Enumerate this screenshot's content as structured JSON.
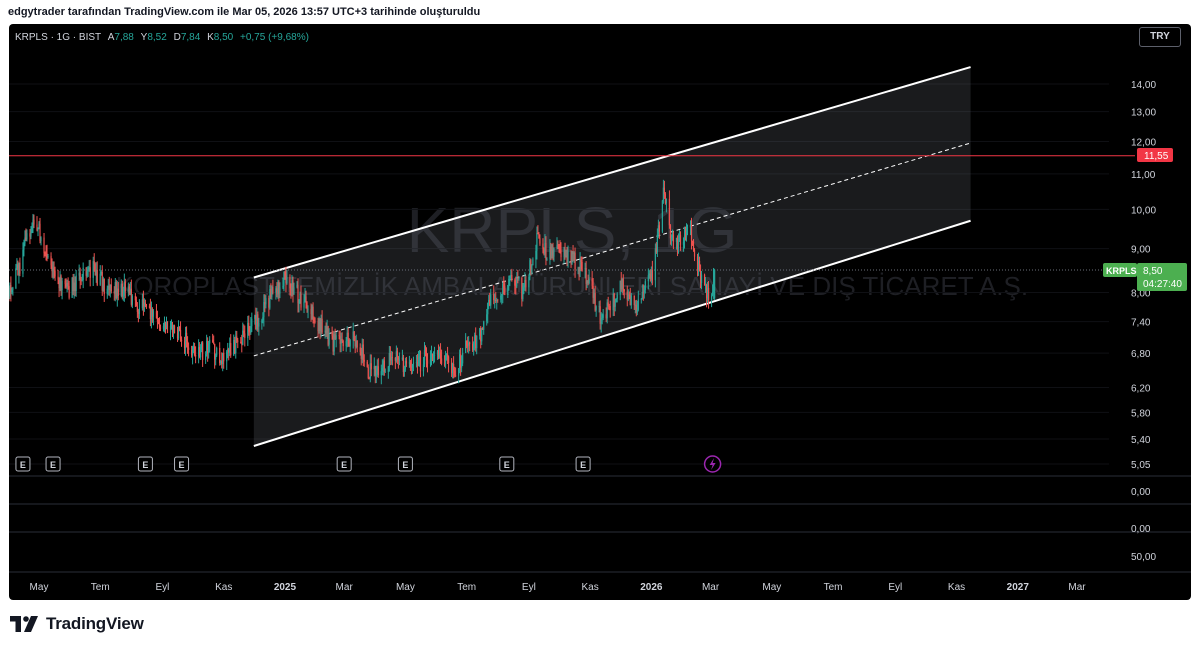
{
  "caption": "edgytrader tarafından TradingView.com ile Mar 05, 2026 13:57 UTC+3 tarihinde oluşturuldu",
  "header": {
    "symbol": "KRPLS · 1G · BIST",
    "open_label": "A",
    "open_value": "7,88",
    "high_label": "Y",
    "high_value": "8,52",
    "low_label": "D",
    "low_value": "7,84",
    "close_label": "K",
    "close_value": "8,50",
    "change": "+0,75 (+9,68%)",
    "currency": "TRY"
  },
  "watermark": {
    "symbol": "KRPLS, 1G",
    "company": "KOROPLAST TEMİZLİK AMBALAJ ÜRÜNLERİ SANAYİ VE DIŞ TİCARET A.Ş."
  },
  "price_badge": {
    "symbol": "KRPLS",
    "price": "8,50",
    "countdown": "04:27:40"
  },
  "level_badge": "11,55",
  "pane_labels": [
    "0,00",
    "0,00",
    "50,00"
  ],
  "earnings_marker": "E",
  "brand": "TradingView",
  "colors": {
    "up": "#26a69a",
    "down": "#ef5350",
    "resistance": "#f23645",
    "price_badge": "#4caf50",
    "flash": "#9c27b0"
  },
  "chart_data": {
    "type": "candlestick",
    "y_scale": "log",
    "y_ticks": [
      14.0,
      13.0,
      12.0,
      11.0,
      10.0,
      9.0,
      8.0,
      7.4,
      6.8,
      6.2,
      5.8,
      5.4,
      5.05
    ],
    "y_tick_labels": [
      "14,00",
      "13,00",
      "12,00",
      "11,00",
      "10,00",
      "9,00",
      "8,00",
      "7,40",
      "6,80",
      "6,20",
      "5,80",
      "5,40",
      "5,05"
    ],
    "x_ticks": [
      {
        "date": "2024-05-01",
        "label": "May",
        "bold": false
      },
      {
        "date": "2024-07-01",
        "label": "Tem",
        "bold": false
      },
      {
        "date": "2024-09-01",
        "label": "Eyl",
        "bold": false
      },
      {
        "date": "2024-11-01",
        "label": "Kas",
        "bold": false
      },
      {
        "date": "2025-01-01",
        "label": "2025",
        "bold": true
      },
      {
        "date": "2025-03-01",
        "label": "Mar",
        "bold": false
      },
      {
        "date": "2025-05-01",
        "label": "May",
        "bold": false
      },
      {
        "date": "2025-07-01",
        "label": "Tem",
        "bold": false
      },
      {
        "date": "2025-09-01",
        "label": "Eyl",
        "bold": false
      },
      {
        "date": "2025-11-01",
        "label": "Kas",
        "bold": false
      },
      {
        "date": "2026-01-01",
        "label": "2026",
        "bold": true
      },
      {
        "date": "2026-03-01",
        "label": "Mar",
        "bold": false
      },
      {
        "date": "2026-05-01",
        "label": "May",
        "bold": false
      },
      {
        "date": "2026-07-01",
        "label": "Tem",
        "bold": false
      },
      {
        "date": "2026-09-01",
        "label": "Eyl",
        "bold": false
      },
      {
        "date": "2026-11-01",
        "label": "Kas",
        "bold": false
      },
      {
        "date": "2027-01-01",
        "label": "2027",
        "bold": true
      },
      {
        "date": "2027-03-01",
        "label": "Mar",
        "bold": false
      }
    ],
    "price_path": [
      [
        "2024-04-01",
        8.1
      ],
      [
        "2024-04-12",
        8.6
      ],
      [
        "2024-04-22",
        9.5
      ],
      [
        "2024-04-28",
        9.8
      ],
      [
        "2024-05-06",
        8.8
      ],
      [
        "2024-05-16",
        8.4
      ],
      [
        "2024-05-28",
        8.0
      ],
      [
        "2024-06-10",
        8.3
      ],
      [
        "2024-06-24",
        8.5
      ],
      [
        "2024-07-10",
        8.0
      ],
      [
        "2024-07-24",
        8.1
      ],
      [
        "2024-08-08",
        7.7
      ],
      [
        "2024-08-22",
        7.6
      ],
      [
        "2024-09-05",
        7.3
      ],
      [
        "2024-09-20",
        7.1
      ],
      [
        "2024-10-05",
        6.8
      ],
      [
        "2024-10-18",
        6.9
      ],
      [
        "2024-11-01",
        6.7
      ],
      [
        "2024-11-15",
        7.0
      ],
      [
        "2024-11-28",
        7.3
      ],
      [
        "2024-12-10",
        7.6
      ],
      [
        "2024-12-20",
        8.0
      ],
      [
        "2025-01-02",
        8.3
      ],
      [
        "2025-01-10",
        8.1
      ],
      [
        "2025-01-22",
        7.7
      ],
      [
        "2025-02-05",
        7.3
      ],
      [
        "2025-02-18",
        7.0
      ],
      [
        "2025-03-03",
        7.1
      ],
      [
        "2025-03-15",
        7.0
      ],
      [
        "2025-03-25",
        6.5
      ],
      [
        "2025-04-08",
        6.6
      ],
      [
        "2025-04-22",
        6.7
      ],
      [
        "2025-05-10",
        6.5
      ],
      [
        "2025-05-24",
        6.8
      ],
      [
        "2025-06-07",
        6.7
      ],
      [
        "2025-06-20",
        6.5
      ],
      [
        "2025-07-01",
        6.9
      ],
      [
        "2025-07-12",
        7.0
      ],
      [
        "2025-07-25",
        7.8
      ],
      [
        "2025-08-05",
        8.0
      ],
      [
        "2025-08-15",
        8.4
      ],
      [
        "2025-08-25",
        8.0
      ],
      [
        "2025-09-03",
        8.6
      ],
      [
        "2025-09-10",
        9.4
      ],
      [
        "2025-09-20",
        8.8
      ],
      [
        "2025-09-30",
        9.0
      ],
      [
        "2025-10-10",
        8.8
      ],
      [
        "2025-10-22",
        8.6
      ],
      [
        "2025-11-03",
        8.0
      ],
      [
        "2025-11-12",
        7.4
      ],
      [
        "2025-11-22",
        7.8
      ],
      [
        "2025-12-05",
        8.2
      ],
      [
        "2025-12-15",
        7.7
      ],
      [
        "2025-12-25",
        8.0
      ],
      [
        "2026-01-02",
        8.4
      ],
      [
        "2026-01-10",
        9.8
      ],
      [
        "2026-01-14",
        10.6
      ],
      [
        "2026-01-20",
        9.4
      ],
      [
        "2026-01-30",
        9.1
      ],
      [
        "2026-02-08",
        9.5
      ],
      [
        "2026-02-16",
        8.6
      ],
      [
        "2026-02-24",
        8.0
      ],
      [
        "2026-03-01",
        7.9
      ],
      [
        "2026-03-05",
        8.5
      ]
    ],
    "last_price": 8.5,
    "drawings": {
      "channel_upper": {
        "start": [
          "2024-12-01",
          8.33
        ],
        "end": [
          "2026-11-15",
          14.65
        ]
      },
      "channel_lower": {
        "start": [
          "2024-12-01",
          5.3
        ],
        "end": [
          "2026-11-15",
          9.7
        ]
      },
      "channel_mid": {
        "start": [
          "2024-12-01",
          6.75
        ],
        "end": [
          "2026-11-15",
          11.95
        ]
      },
      "horizontal_level": 11.55
    },
    "earnings_dates": [
      "2024-04-15",
      "2024-05-15",
      "2024-08-15",
      "2024-09-20",
      "2025-03-01",
      "2025-05-01",
      "2025-08-10",
      "2025-10-25"
    ],
    "event_flash_date": "2026-03-03"
  }
}
